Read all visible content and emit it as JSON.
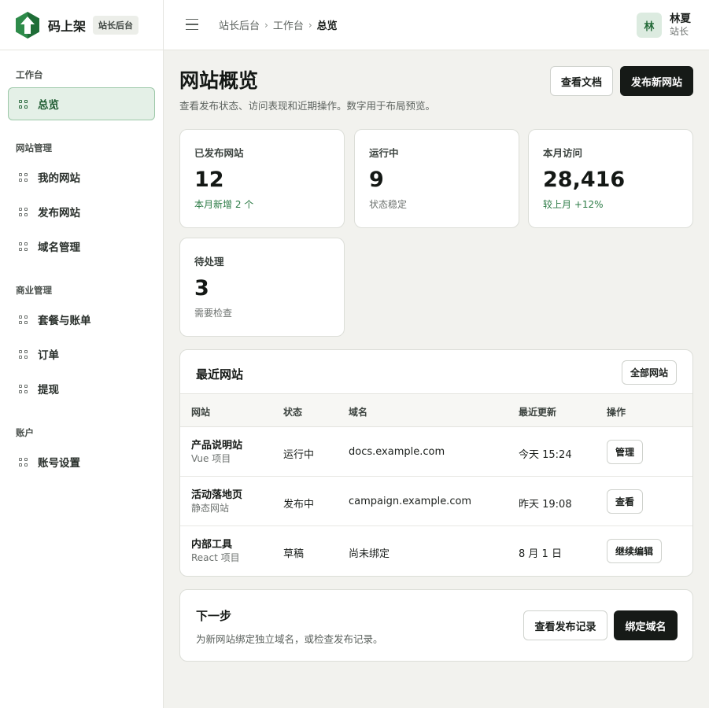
{
  "brand": {
    "name": "码上架",
    "badge": "站长后台"
  },
  "sidebar": {
    "groups": [
      {
        "title": "工作台",
        "items": [
          {
            "label": "总览",
            "active": true
          }
        ]
      },
      {
        "title": "网站管理",
        "items": [
          {
            "label": "我的网站"
          },
          {
            "label": "发布网站"
          },
          {
            "label": "域名管理"
          }
        ]
      },
      {
        "title": "商业管理",
        "items": [
          {
            "label": "套餐与账单"
          },
          {
            "label": "订单"
          },
          {
            "label": "提现"
          }
        ]
      },
      {
        "title": "账户",
        "items": [
          {
            "label": "账号设置"
          }
        ]
      }
    ]
  },
  "topbar": {
    "breadcrumb": [
      "站长后台",
      "工作台",
      "总览"
    ],
    "user": {
      "initial": "林",
      "name": "林夏",
      "role": "站长"
    }
  },
  "page": {
    "title": "网站概览",
    "subtitle": "查看发布状态、访问表现和近期操作。数字用于布局预览。",
    "docs_button": "查看文档",
    "publish_button": "发布新网站"
  },
  "stats": [
    {
      "label": "已发布网站",
      "value": "12",
      "note": "本月新增 2 个",
      "positive": true
    },
    {
      "label": "运行中",
      "value": "9",
      "note": "状态稳定",
      "positive": false
    },
    {
      "label": "本月访问",
      "value": "28,416",
      "note": "较上月 +12%",
      "positive": true
    },
    {
      "label": "待处理",
      "value": "3",
      "note": "需要检查",
      "positive": false
    }
  ],
  "recent": {
    "title": "最近网站",
    "all_button": "全部网站",
    "columns": [
      "网站",
      "状态",
      "域名",
      "最近更新",
      "操作"
    ],
    "rows": [
      {
        "name": "产品说明站",
        "type": "Vue 项目",
        "status": "运行中",
        "domain": "docs.example.com",
        "updated": "今天 15:24",
        "action": "管理"
      },
      {
        "name": "活动落地页",
        "type": "静态网站",
        "status": "发布中",
        "domain": "campaign.example.com",
        "updated": "昨天 19:08",
        "action": "查看"
      },
      {
        "name": "内部工具",
        "type": "React 项目",
        "status": "草稿",
        "domain": "尚未绑定",
        "updated": "8 月 1 日",
        "action": "继续编辑"
      }
    ]
  },
  "next": {
    "title": "下一步",
    "desc": "为新网站绑定独立域名，或检查发布记录。",
    "records_button": "查看发布记录",
    "bind_button": "绑定域名"
  },
  "colors": {
    "accent": "#2d6b40",
    "dark_button": "#161a17",
    "active_bg": "#e4f0e7",
    "positive": "#2a7a44"
  },
  "icons": {
    "brand": "arrow-up-logo-icon",
    "nav": "grid-icon",
    "menu": "menu-icon"
  }
}
